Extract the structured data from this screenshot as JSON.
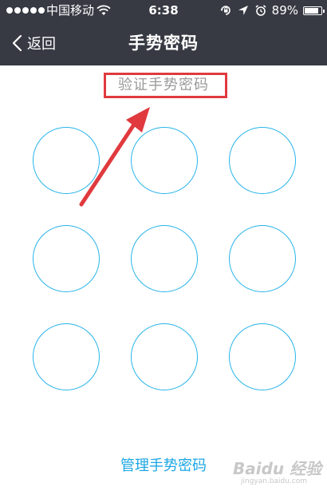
{
  "status_bar": {
    "carrier": "中国移动",
    "time": "6:38",
    "battery_percent": "89%",
    "battery_level": 0.89,
    "icons": [
      "signal-dots-icon",
      "wifi-icon",
      "rotation-lock-icon",
      "location-arrow-icon",
      "alarm-icon",
      "battery-icon"
    ]
  },
  "nav": {
    "back_label": "返回",
    "back_icon": "chevron-left-icon",
    "title": "手势密码"
  },
  "prompt": {
    "text": "验证手势密码",
    "highlight_color": "#e03a3e"
  },
  "pattern": {
    "rows": 3,
    "cols": 3,
    "ring_color": "#28b4ea",
    "nodes": [
      "1",
      "2",
      "3",
      "4",
      "5",
      "6",
      "7",
      "8",
      "9"
    ]
  },
  "footer": {
    "manage_label": "管理手势密码",
    "link_color": "#1ba6e4"
  },
  "watermark": {
    "text": "Baidu 经验",
    "sub": "jingyan.baidu.com"
  },
  "colors": {
    "topbar": "#373a43",
    "background": "#ffffff"
  }
}
